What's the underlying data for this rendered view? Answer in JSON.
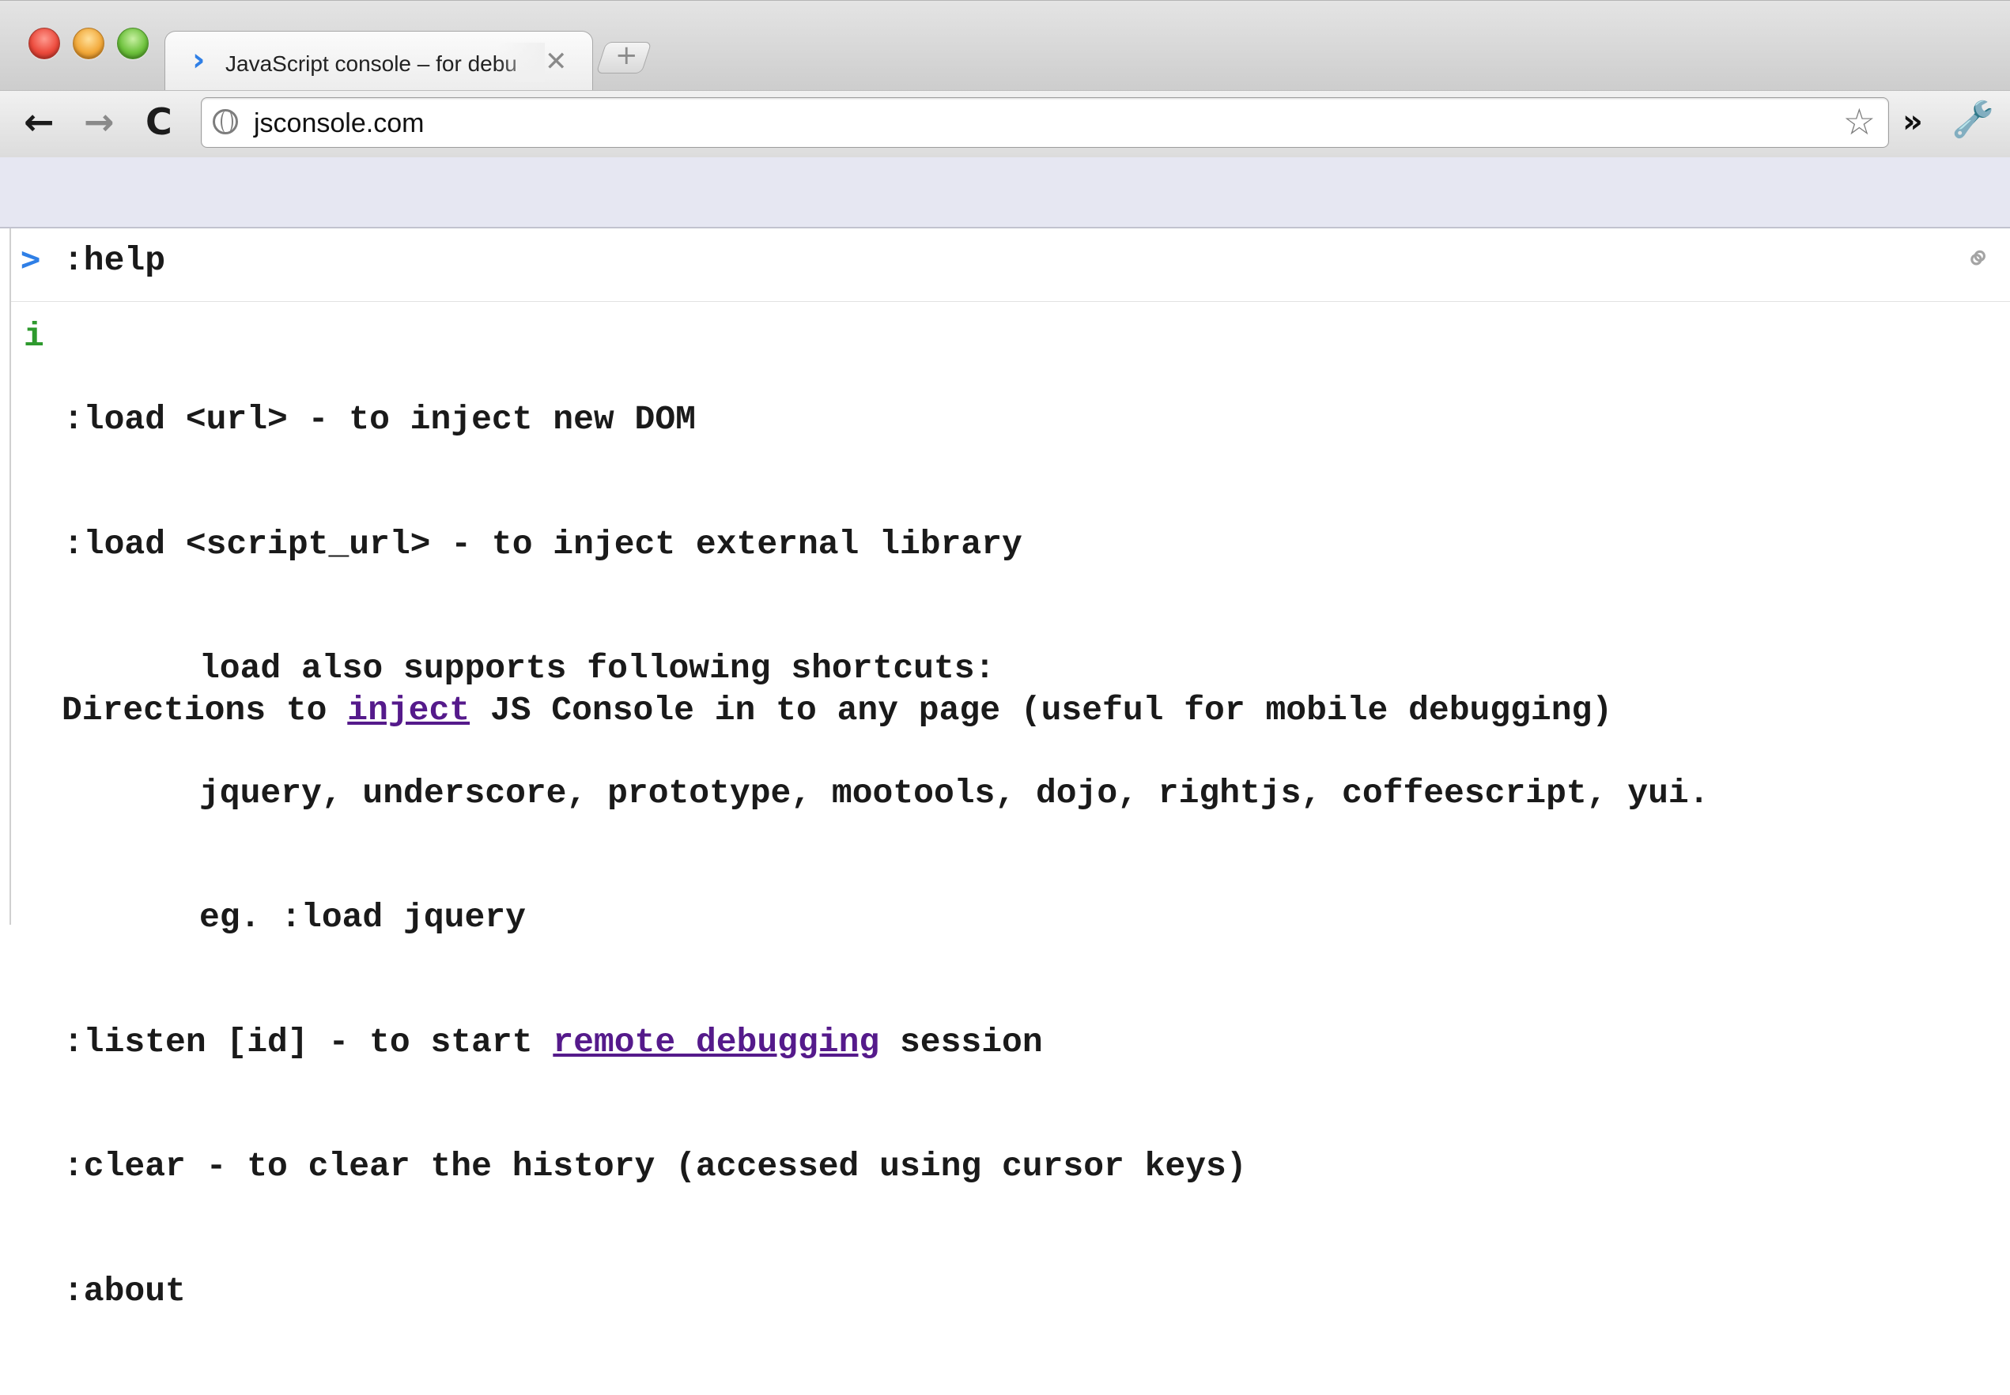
{
  "browser": {
    "tab": {
      "title": "JavaScript console – for debu",
      "icon": "chevron-right-icon",
      "close_glyph": "✕"
    },
    "new_tab_glyph": "+",
    "toolbar": {
      "back_glyph": "🡐",
      "forward_glyph": "🡒",
      "reload_glyph": "C",
      "url": "jsconsole.com",
      "star_glyph": "☆",
      "overflow_glyph": "»",
      "wrench_glyph": "🔧"
    }
  },
  "console": {
    "prompt": ">",
    "input": ":help",
    "link_icon_glyph": "🔗",
    "info_marker": "i",
    "output": {
      "line1": ":load <url> - to inject new DOM",
      "line2": ":load <script_url> - to inject external library",
      "line3": "load also supports following shortcuts:",
      "line4": "jquery, underscore, prototype, mootools, dojo, rightjs, coffeescript, yui.",
      "line5": "eg. :load jquery",
      "line6_pre": ":listen [id] - to start ",
      "line6_link": "remote debugging",
      "line6_post": " session",
      "line7": ":clear - to clear the history (accessed using cursor keys)",
      "line8": ":about"
    },
    "directions": {
      "pre": "Directions to ",
      "link": "inject",
      "post": " JS Console in to any page (useful for mobile debugging)"
    }
  },
  "colors": {
    "prompt": "#2f7fe6",
    "info_marker": "#2e9a2e",
    "link": "#551a8b",
    "bookmark_bar": "#e6e7f2"
  }
}
